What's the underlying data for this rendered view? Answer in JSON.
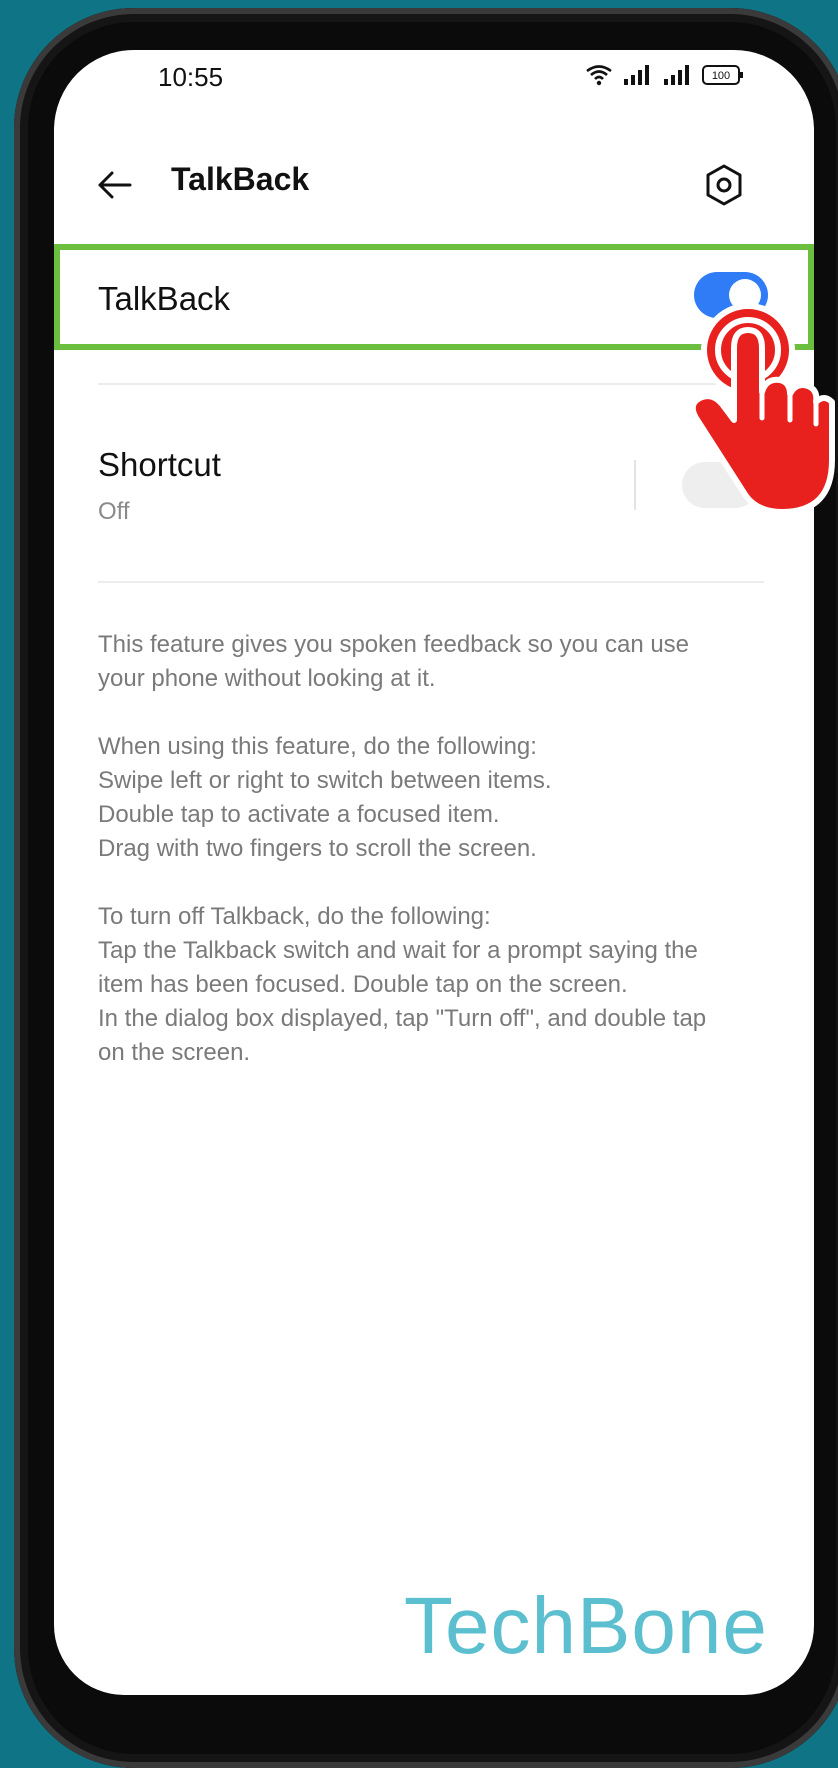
{
  "status_bar": {
    "time": "10:55",
    "battery": "100"
  },
  "app_bar": {
    "title": "TalkBack",
    "back_icon": "arrow-left-icon",
    "settings_icon": "hexagon-settings-icon"
  },
  "talkback_toggle": {
    "label": "TalkBack",
    "state": "on",
    "highlight_color": "#6cbf3e",
    "toggle_color": "#2f7cf6"
  },
  "shortcut": {
    "label": "Shortcut",
    "value": "Off"
  },
  "description": {
    "paragraph1": [
      "This feature gives you spoken feedback so you can use",
      "your phone without looking at it."
    ],
    "paragraph2": [
      "When using this feature, do the following:",
      "Swipe left or right to switch between items.",
      "Double tap to activate a focused item.",
      "Drag with two fingers to scroll the screen."
    ],
    "paragraph3": [
      "To turn off Talkback, do the following:",
      "Tap the Talkback switch and wait for a prompt saying the",
      "item has been focused. Double tap on the screen.",
      "In the dialog box displayed, tap \"Turn off\", and double tap",
      "on the screen."
    ]
  },
  "watermark": "TechBone",
  "overlay": {
    "pointer_icon": "tap-hand-icon",
    "pointer_color": "#e8201e"
  }
}
